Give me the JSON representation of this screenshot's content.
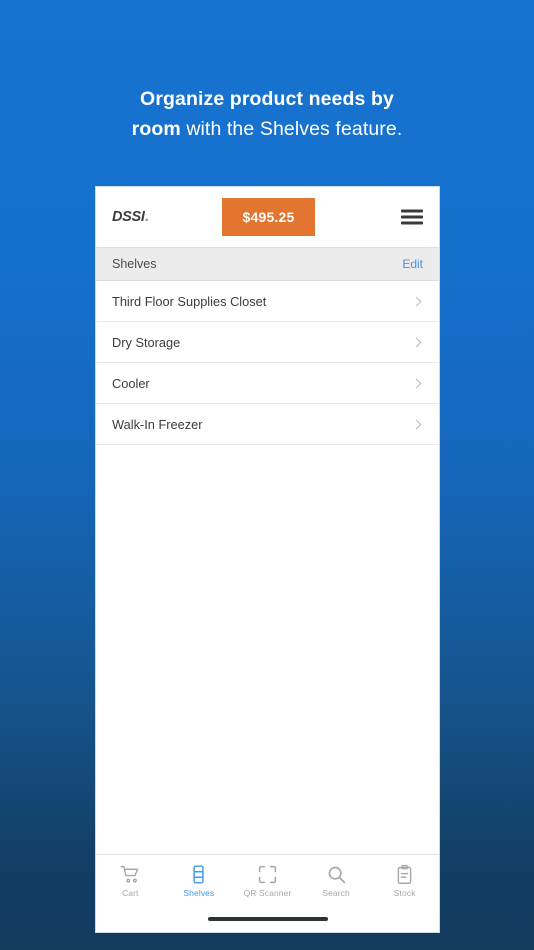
{
  "headline": {
    "bold_part": "Organize product needs by room",
    "rest_part": " with the Shelves feature.",
    "line1_bold": "Organize product needs by",
    "line2_bold": "room",
    "line2_rest": " with the Shelves feature."
  },
  "app": {
    "logo": "DSSI",
    "logo_dot": ".",
    "price_badge": "$495.25",
    "menu_icon": "hamburger-menu-icon"
  },
  "section": {
    "title": "Shelves",
    "edit_label": "Edit"
  },
  "shelves": [
    {
      "name": "Third Floor Supplies Closet",
      "chevron": "chevron-right-icon"
    },
    {
      "name": "Dry Storage",
      "chevron": "chevron-right-icon"
    },
    {
      "name": "Cooler",
      "chevron": "chevron-right-icon"
    },
    {
      "name": "Walk-In Freezer",
      "chevron": "chevron-right-icon"
    }
  ],
  "tabs": [
    {
      "label": "Cart",
      "icon": "shopping-cart-icon",
      "active": false
    },
    {
      "label": "Shelves",
      "icon": "shelves-icon",
      "active": true
    },
    {
      "label": "QR Scanner",
      "icon": "qr-scanner-icon",
      "active": false
    },
    {
      "label": "Search",
      "icon": "search-icon",
      "active": false
    },
    {
      "label": "Stock",
      "icon": "clipboard-icon",
      "active": false
    }
  ],
  "colors": {
    "background_top": "#1673cf",
    "background_bottom": "#123b5e",
    "accent_orange": "#e2752f",
    "link_blue": "#4a8fe0",
    "active_tab_blue": "#3d9bf0"
  }
}
